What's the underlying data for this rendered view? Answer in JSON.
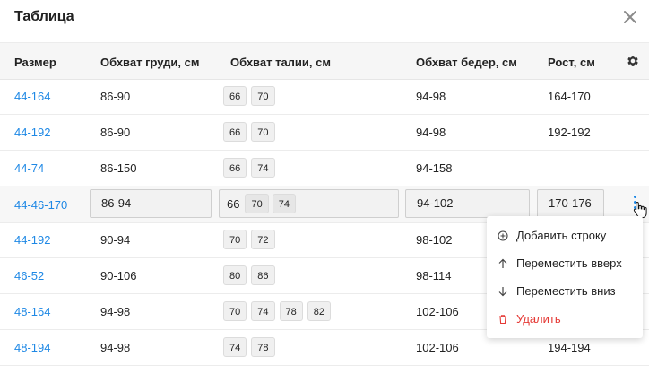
{
  "dialog": {
    "title": "Таблица"
  },
  "columns": [
    "Размер",
    "Обхват груди, см",
    "Обхват талии, см",
    "Обхват бедер, см",
    "Рост, см"
  ],
  "rows": [
    {
      "size": "44-164",
      "chest": "86-90",
      "waist": [
        "66",
        "70"
      ],
      "hips": "94-98",
      "height": "164-170"
    },
    {
      "size": "44-192",
      "chest": "86-90",
      "waist": [
        "66",
        "70"
      ],
      "hips": "94-98",
      "height": "192-192"
    },
    {
      "size": "44-74",
      "chest": "86-150",
      "waist": [
        "66",
        "74"
      ],
      "hips": "94-158",
      "height": ""
    },
    {
      "size": "44-46-170",
      "chest": "86-94",
      "waist": [
        "66",
        "70",
        "74"
      ],
      "hips": "94-102",
      "height": "170-176"
    },
    {
      "size": "44-192",
      "chest": "90-94",
      "waist": [
        "70",
        "72"
      ],
      "hips": "98-102",
      "height": ""
    },
    {
      "size": "46-52",
      "chest": "90-106",
      "waist": [
        "80",
        "86"
      ],
      "hips": "98-114",
      "height": ""
    },
    {
      "size": "48-164",
      "chest": "94-98",
      "waist": [
        "70",
        "74",
        "78",
        "82"
      ],
      "hips": "102-106",
      "height": ""
    },
    {
      "size": "48-194",
      "chest": "94-98",
      "waist": [
        "74",
        "78"
      ],
      "hips": "102-106",
      "height": "194-194"
    }
  ],
  "context_menu": {
    "add_row": "Добавить строку",
    "move_up": "Переместить вверх",
    "move_down": "Переместить вниз",
    "delete": "Удалить"
  },
  "icons": {
    "close": "close-icon",
    "settings": "gear-icon",
    "row_menu": "kebab-icon",
    "add": "plus-circle-icon",
    "up": "arrow-up-icon",
    "down": "arrow-down-icon",
    "delete": "trash-icon"
  },
  "colors": {
    "link": "#1e88e5",
    "danger": "#e53935",
    "header_bg": "#f6f6f6"
  }
}
